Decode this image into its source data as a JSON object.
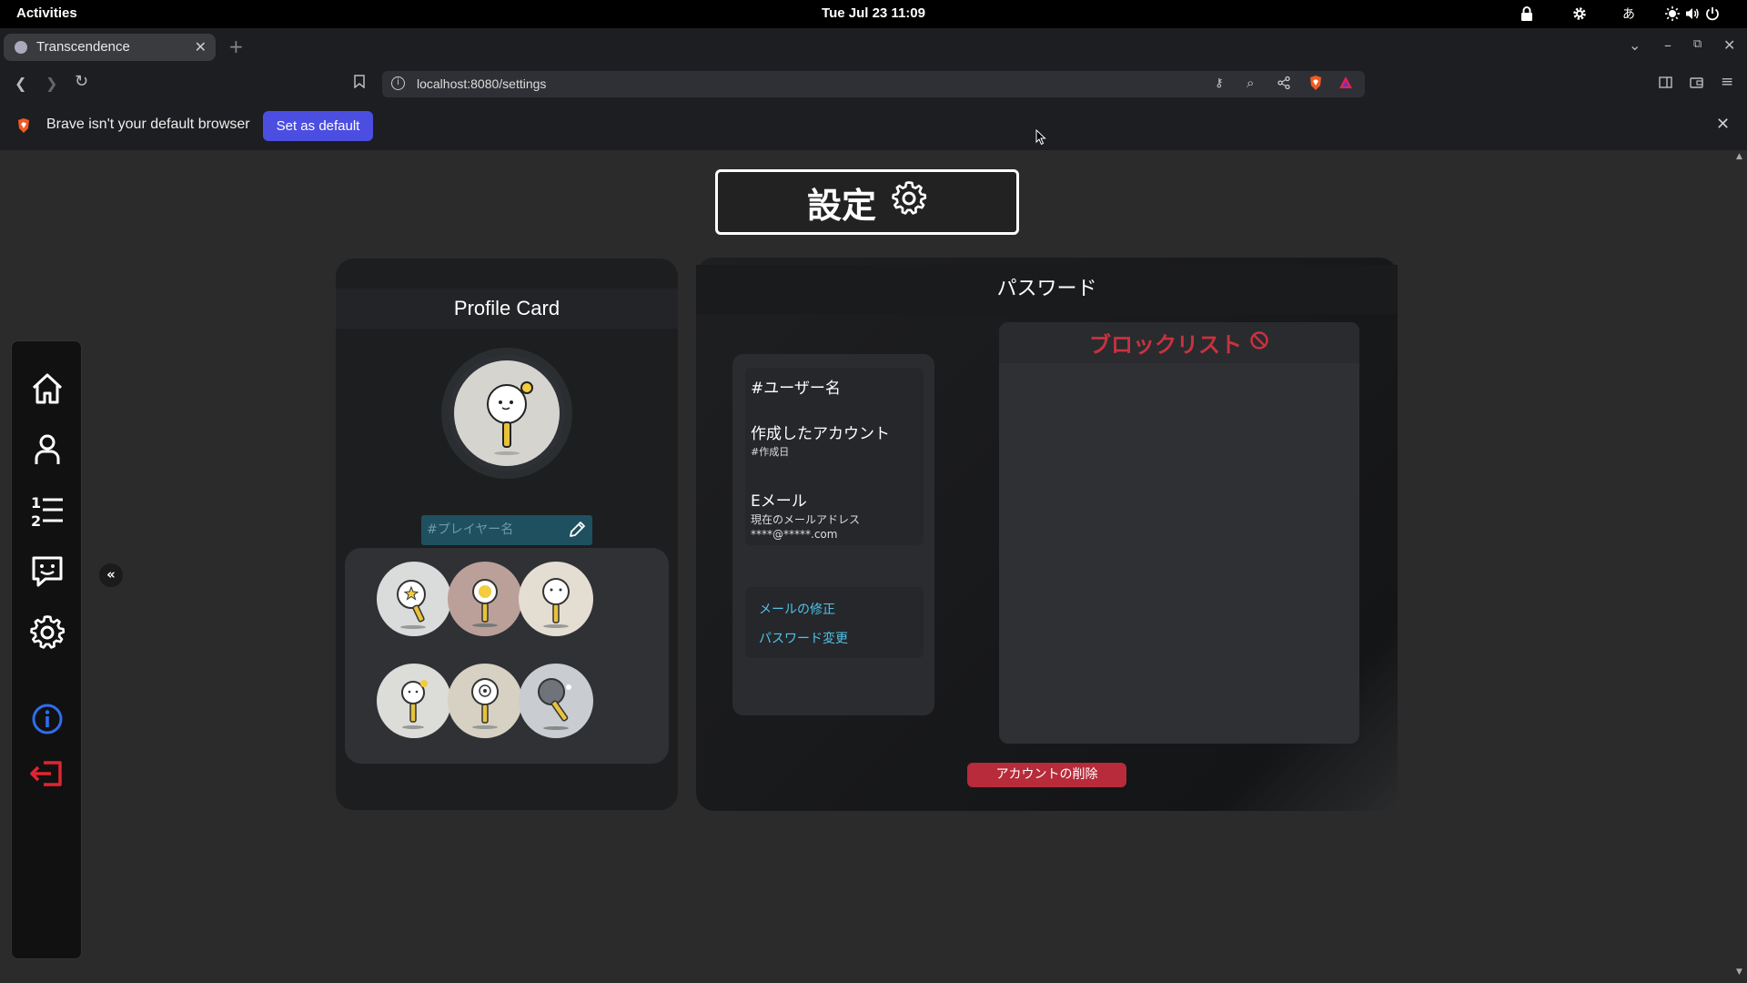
{
  "system_bar": {
    "activities": "Activities",
    "clock": "Tue Jul 23  11:09",
    "input_method": "あ"
  },
  "browser": {
    "tab_title": "Transcendence",
    "url": "localhost:8080/settings",
    "infobar_message": "Brave isn't your default browser",
    "infobar_button": "Set as default"
  },
  "page": {
    "title": "設定",
    "profile_card": {
      "title": "Profile Card",
      "player_name_placeholder": "#プレイヤー名"
    },
    "password_panel": {
      "title": "パスワード",
      "username": "#ユーザー名",
      "created_label": "作成したアカウント",
      "created_date": "#作成日",
      "email_label": "Eメール",
      "current_email_label": "現在のメールアドレス",
      "current_email": "****@*****.com",
      "edit_email_link": "メールの修正",
      "change_password_link": "パスワード変更",
      "blocklist_title": "ブロックリスト",
      "delete_account_button": "アカウントの削除"
    }
  },
  "colors": {
    "accent_blue": "#4b4ee0",
    "danger_red": "#b72b3a",
    "blocklist_red": "#c9323f",
    "link_cyan": "#4fc3e8",
    "info_icon_blue": "#2f6df0",
    "logout_red": "#e02530"
  },
  "icons": {
    "sidebar": [
      "home-icon",
      "user-icon",
      "leaderboard-icon",
      "chat-icon",
      "settings-icon",
      "info-icon",
      "logout-icon"
    ],
    "title": "gear-icon",
    "blocklist": "prohibited-icon"
  }
}
